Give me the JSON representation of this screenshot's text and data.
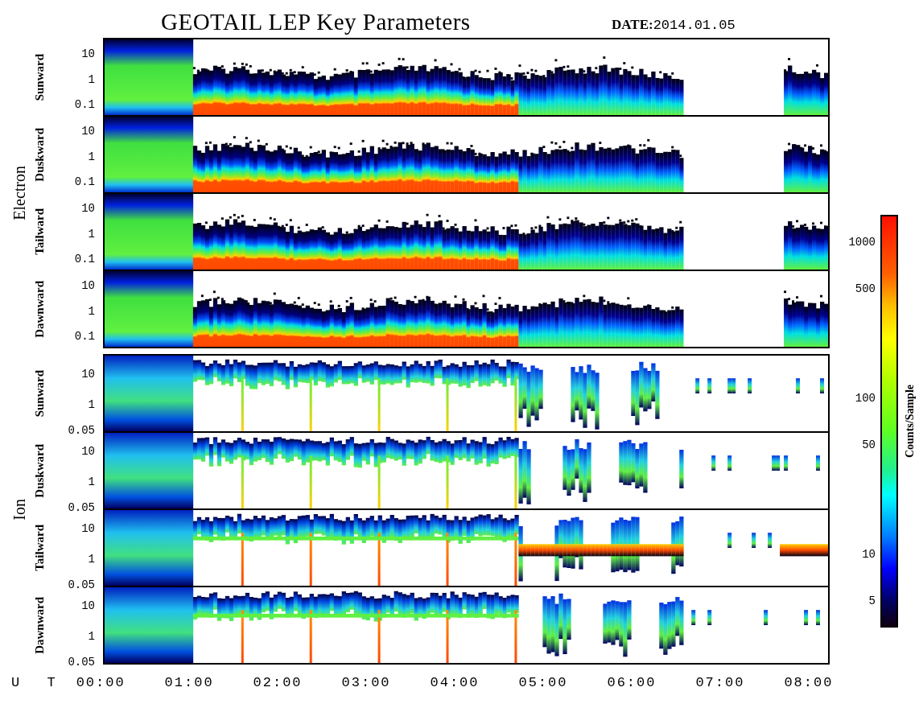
{
  "title": "GEOTAIL LEP Key Parameters",
  "date": {
    "label": "DATE:",
    "value": "2014.01.05"
  },
  "groups": [
    {
      "kind": "electron",
      "label": "Electron",
      "panels": [
        {
          "label": "Sunward",
          "yticks": [
            "10",
            "1",
            "0.1"
          ]
        },
        {
          "label": "Duskward",
          "yticks": [
            "10",
            "1",
            "0.1"
          ]
        },
        {
          "label": "Tailward",
          "yticks": [
            "10",
            "1",
            "0.1"
          ]
        },
        {
          "label": "Dawnward",
          "yticks": [
            "10",
            "1",
            "0.1"
          ]
        }
      ]
    },
    {
      "kind": "ion",
      "label": "Ion",
      "panels": [
        {
          "label": "Sunward",
          "yticks": [
            "10",
            "1",
            "0.05"
          ]
        },
        {
          "label": "Duskward",
          "yticks": [
            "10",
            "1",
            "0.05"
          ]
        },
        {
          "label": "Tailward",
          "yticks": [
            "10",
            "1",
            "0.05"
          ]
        },
        {
          "label": "Dawnward",
          "yticks": [
            "10",
            "1",
            "0.05"
          ]
        }
      ]
    }
  ],
  "x_axis": {
    "label": "U T",
    "ticks": [
      "00:00",
      "01:00",
      "02:00",
      "03:00",
      "04:00",
      "05:00",
      "06:00",
      "07:00",
      "08:00"
    ]
  },
  "colorbar": {
    "label": "Counts/Sample",
    "ticks": [
      "1000",
      "500",
      "100",
      "50",
      "10",
      "5"
    ]
  }
}
